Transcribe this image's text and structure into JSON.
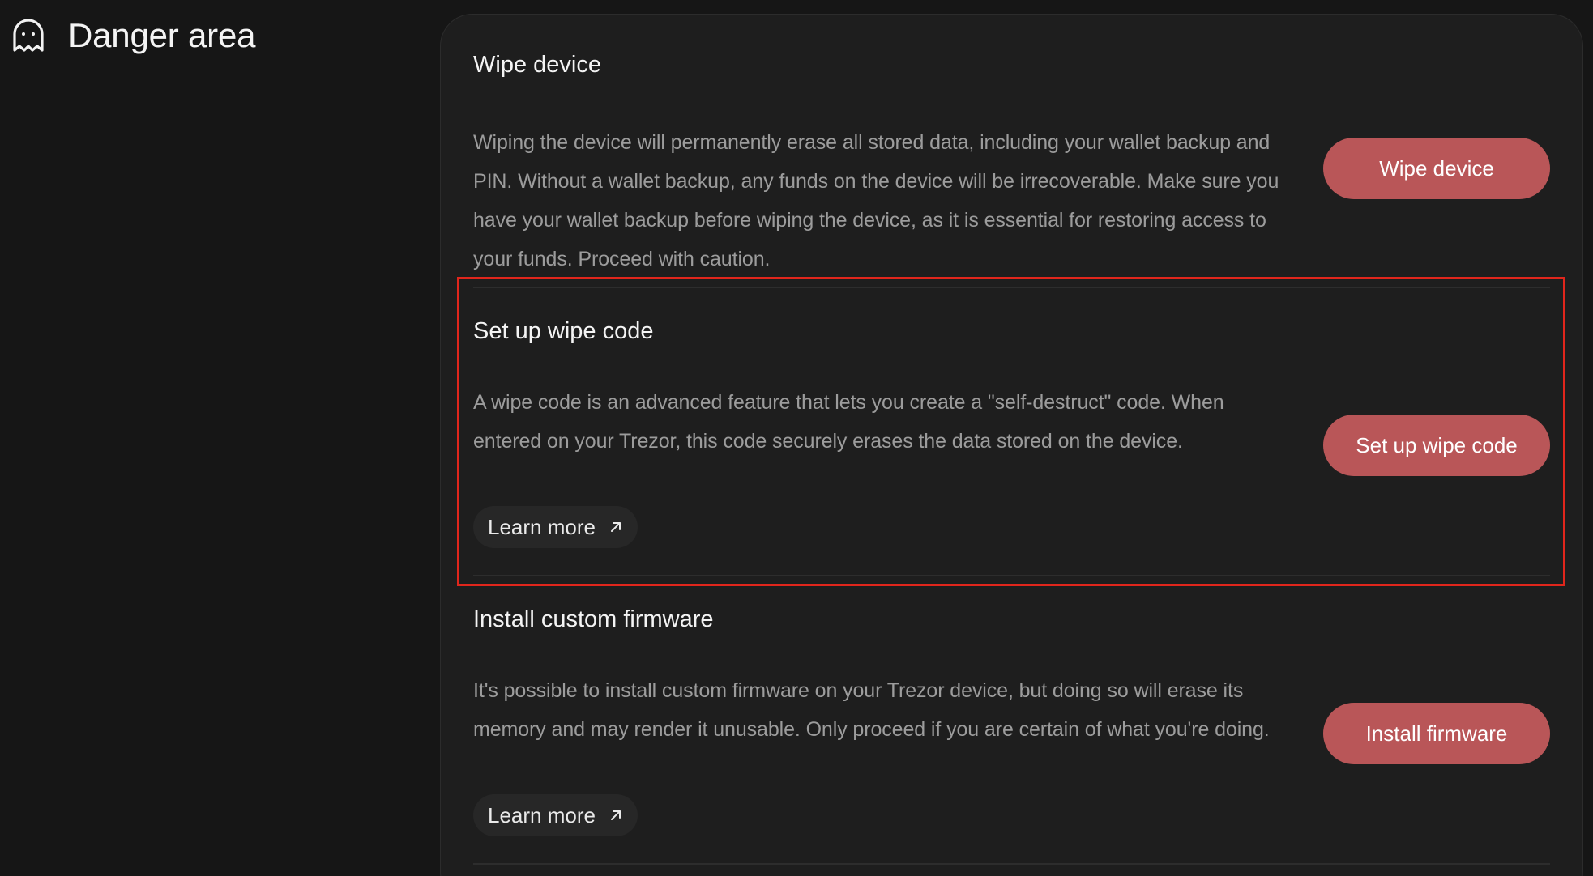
{
  "header": {
    "title": "Danger area",
    "icon": "ghost-icon"
  },
  "sections": [
    {
      "title": "Wipe device",
      "description": "Wiping the device will permanently erase all stored data, including your wallet backup and PIN. Without a wallet backup, any funds on the device will be irrecoverable. Make sure you have your wallet backup before wiping the device, as it is essential for restoring access to your funds. Proceed with caution.",
      "button_label": "Wipe device"
    },
    {
      "title": "Set up wipe code",
      "description": "A wipe code is an advanced feature that lets you create a \"self-destruct\" code. When entered on your Trezor, this code securely erases the data stored on the device.",
      "link_label": "Learn more",
      "button_label": "Set up wipe code"
    },
    {
      "title": "Install custom firmware",
      "description": "It's possible to install custom firmware on your Trezor device, but doing so will erase its memory and may render it unusable. Only proceed if you are certain of what you're doing.",
      "link_label": "Learn more",
      "button_label": "Install firmware"
    }
  ],
  "colors": {
    "background": "#161616",
    "card": "#1e1e1e",
    "danger_button": "#b95658",
    "highlight": "#e0261c"
  }
}
